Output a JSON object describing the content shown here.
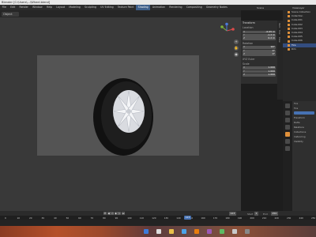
{
  "window": {
    "title": "Blender [C:\\Users\\...\\Wheel.blend]"
  },
  "menu": {
    "items": [
      "File",
      "Edit",
      "Render",
      "Window",
      "Help",
      "Layout",
      "Modeling",
      "Sculpting",
      "UV Editing",
      "Texture Paint",
      "Shading",
      "Animation",
      "Rendering",
      "Compositing",
      "Geometry Nodes",
      "Scripting"
    ],
    "active": "Shading"
  },
  "topright": {
    "scene_label": "Scene",
    "view_layer_label": "ViewLayer"
  },
  "viewport": {
    "mode_label": "Object Mode",
    "view_label": "Object"
  },
  "npanel": {
    "sections": {
      "transform": "Transform",
      "location": "Location",
      "rotation": "Rotation",
      "mode": "XYZ Euler",
      "scale": "Scale"
    },
    "location": [
      {
        "axis": "X",
        "value": "-0.45 m"
      },
      {
        "axis": "Y",
        "value": "-1.2 m"
      },
      {
        "axis": "Z",
        "value": "0.2 m"
      }
    ],
    "rotation": [
      {
        "axis": "X",
        "value": "90°"
      },
      {
        "axis": "Y",
        "value": "0°"
      },
      {
        "axis": "Z",
        "value": "0°"
      }
    ],
    "scale": [
      {
        "axis": "X",
        "value": "1.000"
      },
      {
        "axis": "Y",
        "value": "1.000"
      },
      {
        "axis": "Z",
        "value": "1.000"
      }
    ],
    "tabs": [
      "Item",
      "Tool",
      "View"
    ]
  },
  "outliner": {
    "items": [
      {
        "label": "Scene Collection",
        "selected": false
      },
      {
        "label": "Collection",
        "selected": false
      },
      {
        "label": "Cube.001",
        "selected": false
      },
      {
        "label": "Cube.002",
        "selected": false
      },
      {
        "label": "Cube.003",
        "selected": false
      },
      {
        "label": "Cube.004",
        "selected": false
      },
      {
        "label": "Cube.005",
        "selected": false
      },
      {
        "label": "Cube.006",
        "selected": false
      },
      {
        "label": "Tire",
        "selected": true
      },
      {
        "label": "Rim",
        "selected": false
      }
    ]
  },
  "properties": {
    "lines": [
      "Tire",
      "Tire",
      "Transform",
      "Delta",
      "Relations",
      "Collections",
      "Instancing",
      "Visibility"
    ]
  },
  "timeline": {
    "ticks": [
      "0",
      "10",
      "20",
      "30",
      "40",
      "50",
      "60",
      "70",
      "80",
      "90",
      "100",
      "110",
      "120",
      "130",
      "140",
      "150",
      "160",
      "170",
      "180",
      "190",
      "200",
      "210",
      "220",
      "230",
      "240",
      "250"
    ],
    "current_frame": "123",
    "start_label": "Start",
    "start": "1",
    "end_label": "End",
    "end": "250"
  },
  "colors": {
    "accent": "#4772b3",
    "tire": "#111111",
    "rim": "#e8eaee",
    "viewport": "#393939"
  }
}
